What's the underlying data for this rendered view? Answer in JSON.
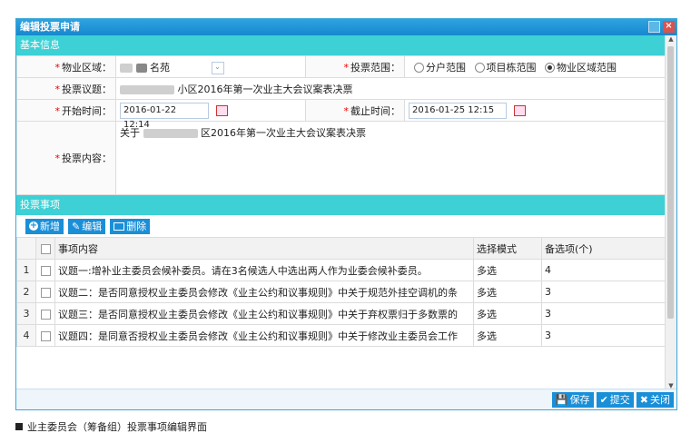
{
  "window": {
    "title": "编辑投票申请",
    "max_icon": "restore-icon",
    "close_icon": "close-icon",
    "close_glyph": "×"
  },
  "basic": {
    "section_title": "基本信息",
    "area_label": "物业区域：",
    "area_value": "名苑",
    "range_label": "投票范围：",
    "range_options": [
      "分户范围",
      "项目栋范围",
      "物业区域范围"
    ],
    "range_selected": "物业区域范围",
    "topic_label": "投票议题：",
    "topic_value": "小区2016年第一次业主大会议案表决票",
    "start_label": "开始时间：",
    "start_value": "2016-01-22 12:14",
    "end_label": "截止时间：",
    "end_value": "2016-01-25 12:15",
    "content_label": "投票内容：",
    "content_prefix": "关于",
    "content_value": "区2016年第一次业主大会议案表决票"
  },
  "items": {
    "section_title": "投票事项",
    "toolbar": {
      "add": "新增",
      "edit": "编辑",
      "delete": "删除"
    },
    "columns": {
      "content": "事项内容",
      "mode": "选择模式",
      "options": "备选项(个)"
    },
    "rows": [
      {
        "no": "1",
        "content": "议题一:增补业主委员会候补委员。请在3名候选人中选出两人作为业委会候补委员。",
        "mode": "多选",
        "options": "4"
      },
      {
        "no": "2",
        "content": "议题二：是否同意授权业主委员会修改《业主公约和议事规则》中关于规范外挂空调机的条",
        "mode": "多选",
        "options": "3"
      },
      {
        "no": "3",
        "content": "议题三：是否同意授权业主委员会修改《业主公约和议事规则》中关于弃权票归于多数票的",
        "mode": "多选",
        "options": "3"
      },
      {
        "no": "4",
        "content": "议题四：是同意否授权业主委员会修改《业主公约和议事规则》中关于修改业主委员会工作",
        "mode": "多选",
        "options": "3"
      }
    ]
  },
  "actions": {
    "save": "保存",
    "submit": "提交",
    "close": "关闭"
  },
  "caption": "业主委员会（筹备组）投票事项编辑界面"
}
